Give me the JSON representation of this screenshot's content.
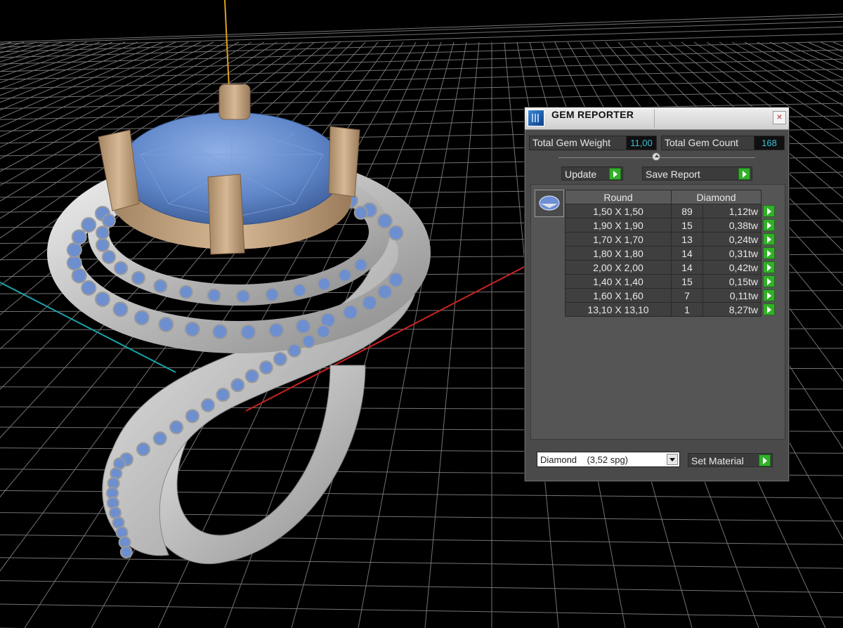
{
  "panel": {
    "title": "GEM REPORTER",
    "close_label": "×",
    "total_gem_weight_label": "Total Gem Weight",
    "total_gem_weight_value": "11,00",
    "total_gem_count_label": "Total Gem Count",
    "total_gem_count_value": "168",
    "update_label": "Update",
    "save_report_label": "Save Report",
    "table": {
      "headers": [
        "Round",
        "Diamond"
      ],
      "rows": [
        {
          "size": "1,50 X 1,50",
          "count": "89",
          "weight": "1,12tw"
        },
        {
          "size": "1,90 X 1,90",
          "count": "15",
          "weight": "0,38tw"
        },
        {
          "size": "1,70 X 1,70",
          "count": "13",
          "weight": "0,24tw"
        },
        {
          "size": "1,80 X 1,80",
          "count": "14",
          "weight": "0,31tw"
        },
        {
          "size": "2,00 X 2,00",
          "count": "14",
          "weight": "0,42tw"
        },
        {
          "size": "1,40 X 1,40",
          "count": "15",
          "weight": "0,15tw"
        },
        {
          "size": "1,60 X 1,60",
          "count": "7",
          "weight": "0,11tw"
        },
        {
          "size": "13,10 X 13,10",
          "count": "1",
          "weight": "8,27tw"
        }
      ]
    },
    "material_value": "Diamond    (3,52 spg)",
    "set_material_label": "Set Material"
  },
  "colors": {
    "accent_green": "#33b02a",
    "value_cyan": "#37c0d8",
    "gem_blue": "#5f86c9",
    "metal_silver": "#c9c9c9",
    "prong_bronze": "#c0a07e"
  }
}
